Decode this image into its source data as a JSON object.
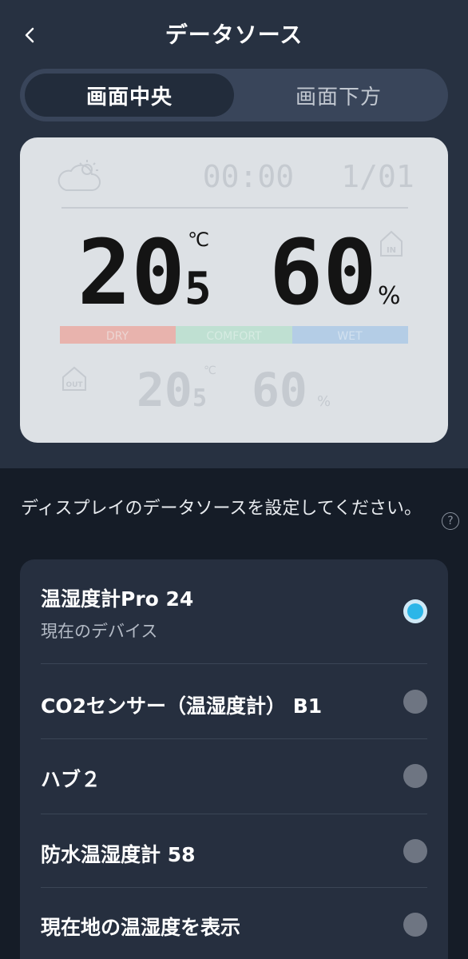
{
  "header": {
    "title": "データソース",
    "back_icon": "chevron-left-icon"
  },
  "tabs": [
    {
      "label": "画面中央",
      "active": true
    },
    {
      "label": "画面下方",
      "active": false
    }
  ],
  "device_display": {
    "time": "00:00",
    "date": "1/01",
    "indoor_label": "IN",
    "outdoor_label": "OUT",
    "temperature_main": "20",
    "temperature_decimal": "5",
    "temperature_unit": "℃",
    "humidity": "60",
    "humidity_unit": "%",
    "comfort_bar": [
      {
        "label": "DRY",
        "color": "#e8b3ad"
      },
      {
        "label": "COMFORT",
        "color": "#bfe0d2"
      },
      {
        "label": "WET",
        "color": "#b4cde6"
      }
    ],
    "outdoor_temperature_main": "20",
    "outdoor_temperature_decimal": "5",
    "outdoor_humidity": "60"
  },
  "description": "ディスプレイのデータソースを設定してください。",
  "sources": [
    {
      "title": "温湿度計Pro 24",
      "subtitle": "現在のデバイス",
      "selected": true
    },
    {
      "title": "CO2センサー（温湿度計） B1",
      "selected": false
    },
    {
      "title": "ハブ２",
      "selected": false
    },
    {
      "title": "防水温湿度計 58",
      "selected": false
    },
    {
      "title": "現在地の温湿度を表示",
      "selected": false
    }
  ],
  "colors": {
    "background": "#151c27",
    "panel": "#273141",
    "accent": "#2cb6e8"
  }
}
